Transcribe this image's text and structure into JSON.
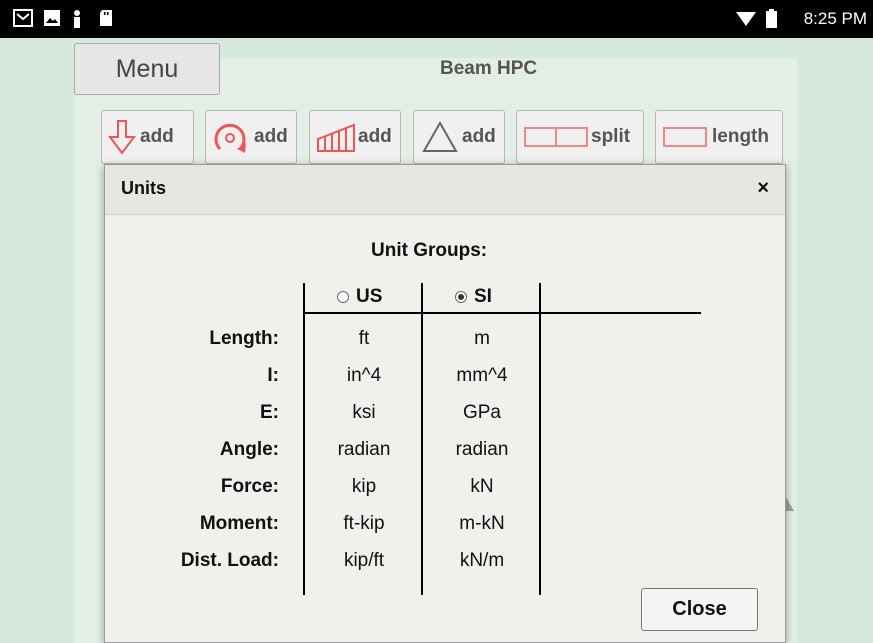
{
  "status_bar": {
    "time": "8:25 PM",
    "left_icons": [
      "gmail-icon",
      "image-icon",
      "figure-icon",
      "sd-card-icon"
    ],
    "right_icons": [
      "wifi-icon",
      "battery-icon"
    ]
  },
  "app": {
    "menu_label": "Menu",
    "title": "Beam HPC",
    "toolbar": [
      {
        "icon": "point-load-icon",
        "label": "add"
      },
      {
        "icon": "moment-icon",
        "label": "add"
      },
      {
        "icon": "distributed-load-icon",
        "label": "add"
      },
      {
        "icon": "support-icon",
        "label": "add"
      },
      {
        "icon": "split-icon",
        "label": "split"
      },
      {
        "icon": "length-icon",
        "label": "length"
      }
    ]
  },
  "dialog": {
    "title": "Units",
    "close_x": "×",
    "groups_title": "Unit Groups:",
    "columns": [
      {
        "label": "US",
        "selected": false
      },
      {
        "label": "SI",
        "selected": true
      }
    ],
    "rows": [
      {
        "label": "Length:",
        "us": "ft",
        "si": "m"
      },
      {
        "label": "I:",
        "us": "in^4",
        "si": "mm^4"
      },
      {
        "label": "E:",
        "us": "ksi",
        "si": "GPa"
      },
      {
        "label": "Angle:",
        "us": "radian",
        "si": "radian"
      },
      {
        "label": "Force:",
        "us": "kip",
        "si": "kN"
      },
      {
        "label": "Moment:",
        "us": "ft-kip",
        "si": "m-kN"
      },
      {
        "label": "Dist. Load:",
        "us": "kip/ft",
        "si": "kN/m"
      }
    ],
    "close_button": "Close"
  }
}
